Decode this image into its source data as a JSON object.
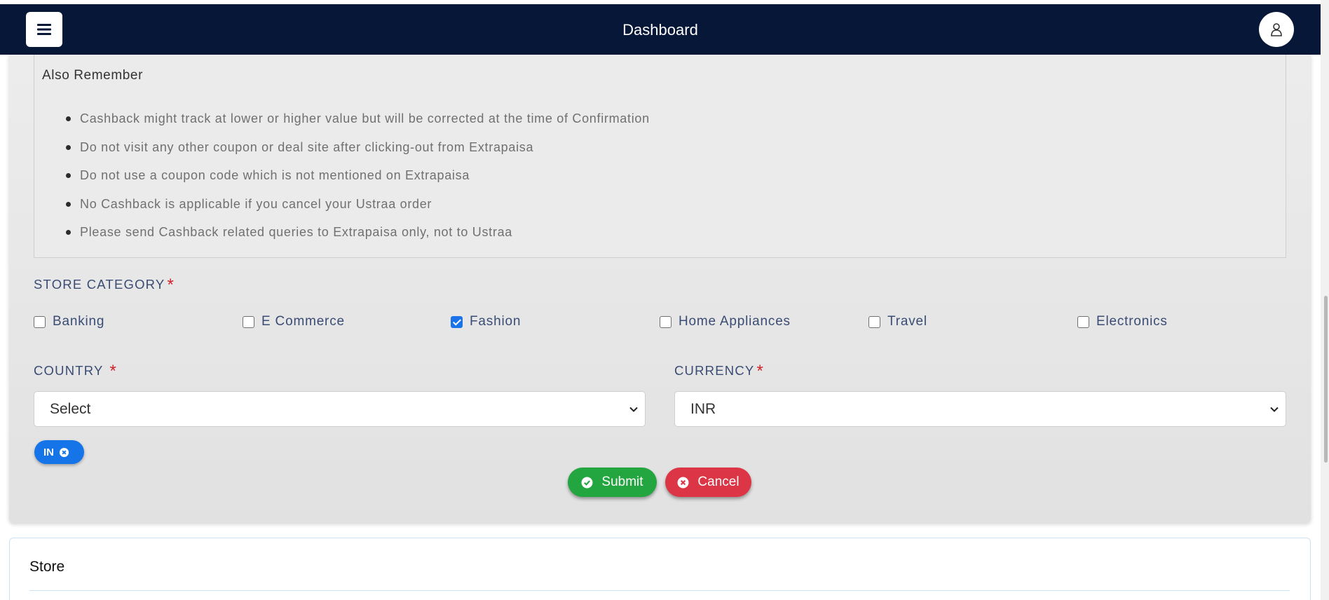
{
  "header": {
    "title": "Dashboard"
  },
  "remember": {
    "title": "Also Remember",
    "items": [
      "Cashback might track at lower or higher value but will be corrected at the time of Confirmation",
      "Do not visit any other coupon or deal site after clicking-out from Extrapaisa",
      "Do not use a coupon code which is not mentioned on Extrapaisa",
      "No Cashback is applicable if you cancel your Ustraa order",
      "Please send Cashback related queries to Extrapaisa only, not to Ustraa"
    ]
  },
  "store_category": {
    "label": "STORE CATEGORY",
    "required_mark": "*",
    "options": [
      {
        "label": "Banking",
        "checked": false
      },
      {
        "label": "E Commerce",
        "checked": false
      },
      {
        "label": "Fashion",
        "checked": true
      },
      {
        "label": "Home Appliances",
        "checked": false
      },
      {
        "label": "Travel",
        "checked": false
      },
      {
        "label": "Electronics",
        "checked": false
      }
    ]
  },
  "country": {
    "label": "COUNTRY",
    "required_mark": "*",
    "selected": "Select",
    "chips": [
      "IN"
    ]
  },
  "currency": {
    "label": "CURRENCY",
    "required_mark": "*",
    "selected": "INR"
  },
  "actions": {
    "submit_label": "Submit",
    "cancel_label": "Cancel"
  },
  "store": {
    "title": "Store"
  },
  "colors": {
    "navbar": "#061737",
    "submit": "#23a540",
    "cancel": "#dc3545",
    "chip": "#1474e8",
    "required": "#d1222c"
  },
  "icons": {
    "menu": "hamburger-icon",
    "user": "user-icon",
    "submit": "check-circle-icon",
    "cancel": "x-circle-icon",
    "chip_remove": "x-circle-icon",
    "dropdown": "chevron-down-icon"
  }
}
